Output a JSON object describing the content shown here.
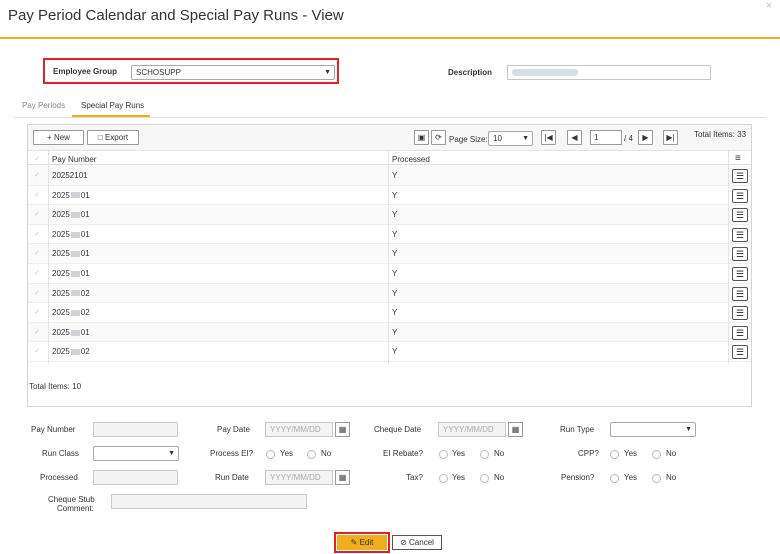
{
  "window": {
    "title": "Pay Period Calendar and Special Pay Runs - View",
    "close_glyph": "×"
  },
  "filters": {
    "employee_group_label": "Employee Group",
    "employee_group_value": "SCHOSUPP",
    "description_label": "Description"
  },
  "tabs": [
    {
      "label": "Pay Periods",
      "active": false
    },
    {
      "label": "Special Pay Runs",
      "active": true
    }
  ],
  "toolbar": {
    "new_label": "New",
    "export_label": "Export",
    "page_size_label": "Page Size:",
    "page_size_value": "10",
    "page_value": "1",
    "page_total": "/ 4",
    "total_items_top": "Total Items: 33"
  },
  "grid": {
    "columns": [
      "Pay Number",
      "Processed"
    ],
    "rows": [
      {
        "pay_number_prefix": "20252101",
        "suffix": "",
        "processed": "Y"
      },
      {
        "pay_number_prefix": "2025",
        "suffix": "01",
        "processed": "Y"
      },
      {
        "pay_number_prefix": "2025",
        "suffix": "01",
        "processed": "Y"
      },
      {
        "pay_number_prefix": "2025",
        "suffix": "01",
        "processed": "Y"
      },
      {
        "pay_number_prefix": "2025",
        "suffix": "01",
        "processed": "Y"
      },
      {
        "pay_number_prefix": "2025",
        "suffix": "01",
        "processed": "Y"
      },
      {
        "pay_number_prefix": "2025",
        "suffix": "02",
        "processed": "Y"
      },
      {
        "pay_number_prefix": "2025",
        "suffix": "02",
        "processed": "Y"
      },
      {
        "pay_number_prefix": "2025",
        "suffix": "01",
        "processed": "Y"
      },
      {
        "pay_number_prefix": "2025",
        "suffix": "02",
        "processed": "Y"
      }
    ],
    "total_items_bottom": "Total Items: 10"
  },
  "form": {
    "pay_number_label": "Pay Number",
    "pay_date_label": "Pay Date",
    "cheque_date_label": "Cheque Date",
    "run_type_label": "Run Type",
    "run_class_label": "Run Class",
    "process_ei_label": "Process EI?",
    "ei_rebate_label": "EI Rebate?",
    "cpp_label": "CPP?",
    "processed_label": "Processed",
    "run_date_label": "Run Date",
    "tax_label": "Tax?",
    "pension_label": "Pension?",
    "cheque_stub_label_1": "Cheque Stub",
    "cheque_stub_label_2": "Comment:",
    "date_placeholder": "YYYY/MM/DD",
    "yes": "Yes",
    "no": "No"
  },
  "actions": {
    "edit_label": "Edit",
    "cancel_label": "Cancel"
  },
  "colors": {
    "accent": "#f0ad1d",
    "highlight_border": "#d9252a"
  },
  "icons": [
    "close-icon",
    "plus-icon",
    "export-icon",
    "save-icon",
    "refresh-icon",
    "first-page-icon",
    "prev-page-icon",
    "next-page-icon",
    "last-page-icon",
    "column-menu-icon",
    "row-details-icon",
    "calendar-icon",
    "edit-icon",
    "cancel-icon",
    "chevron-down-icon"
  ]
}
